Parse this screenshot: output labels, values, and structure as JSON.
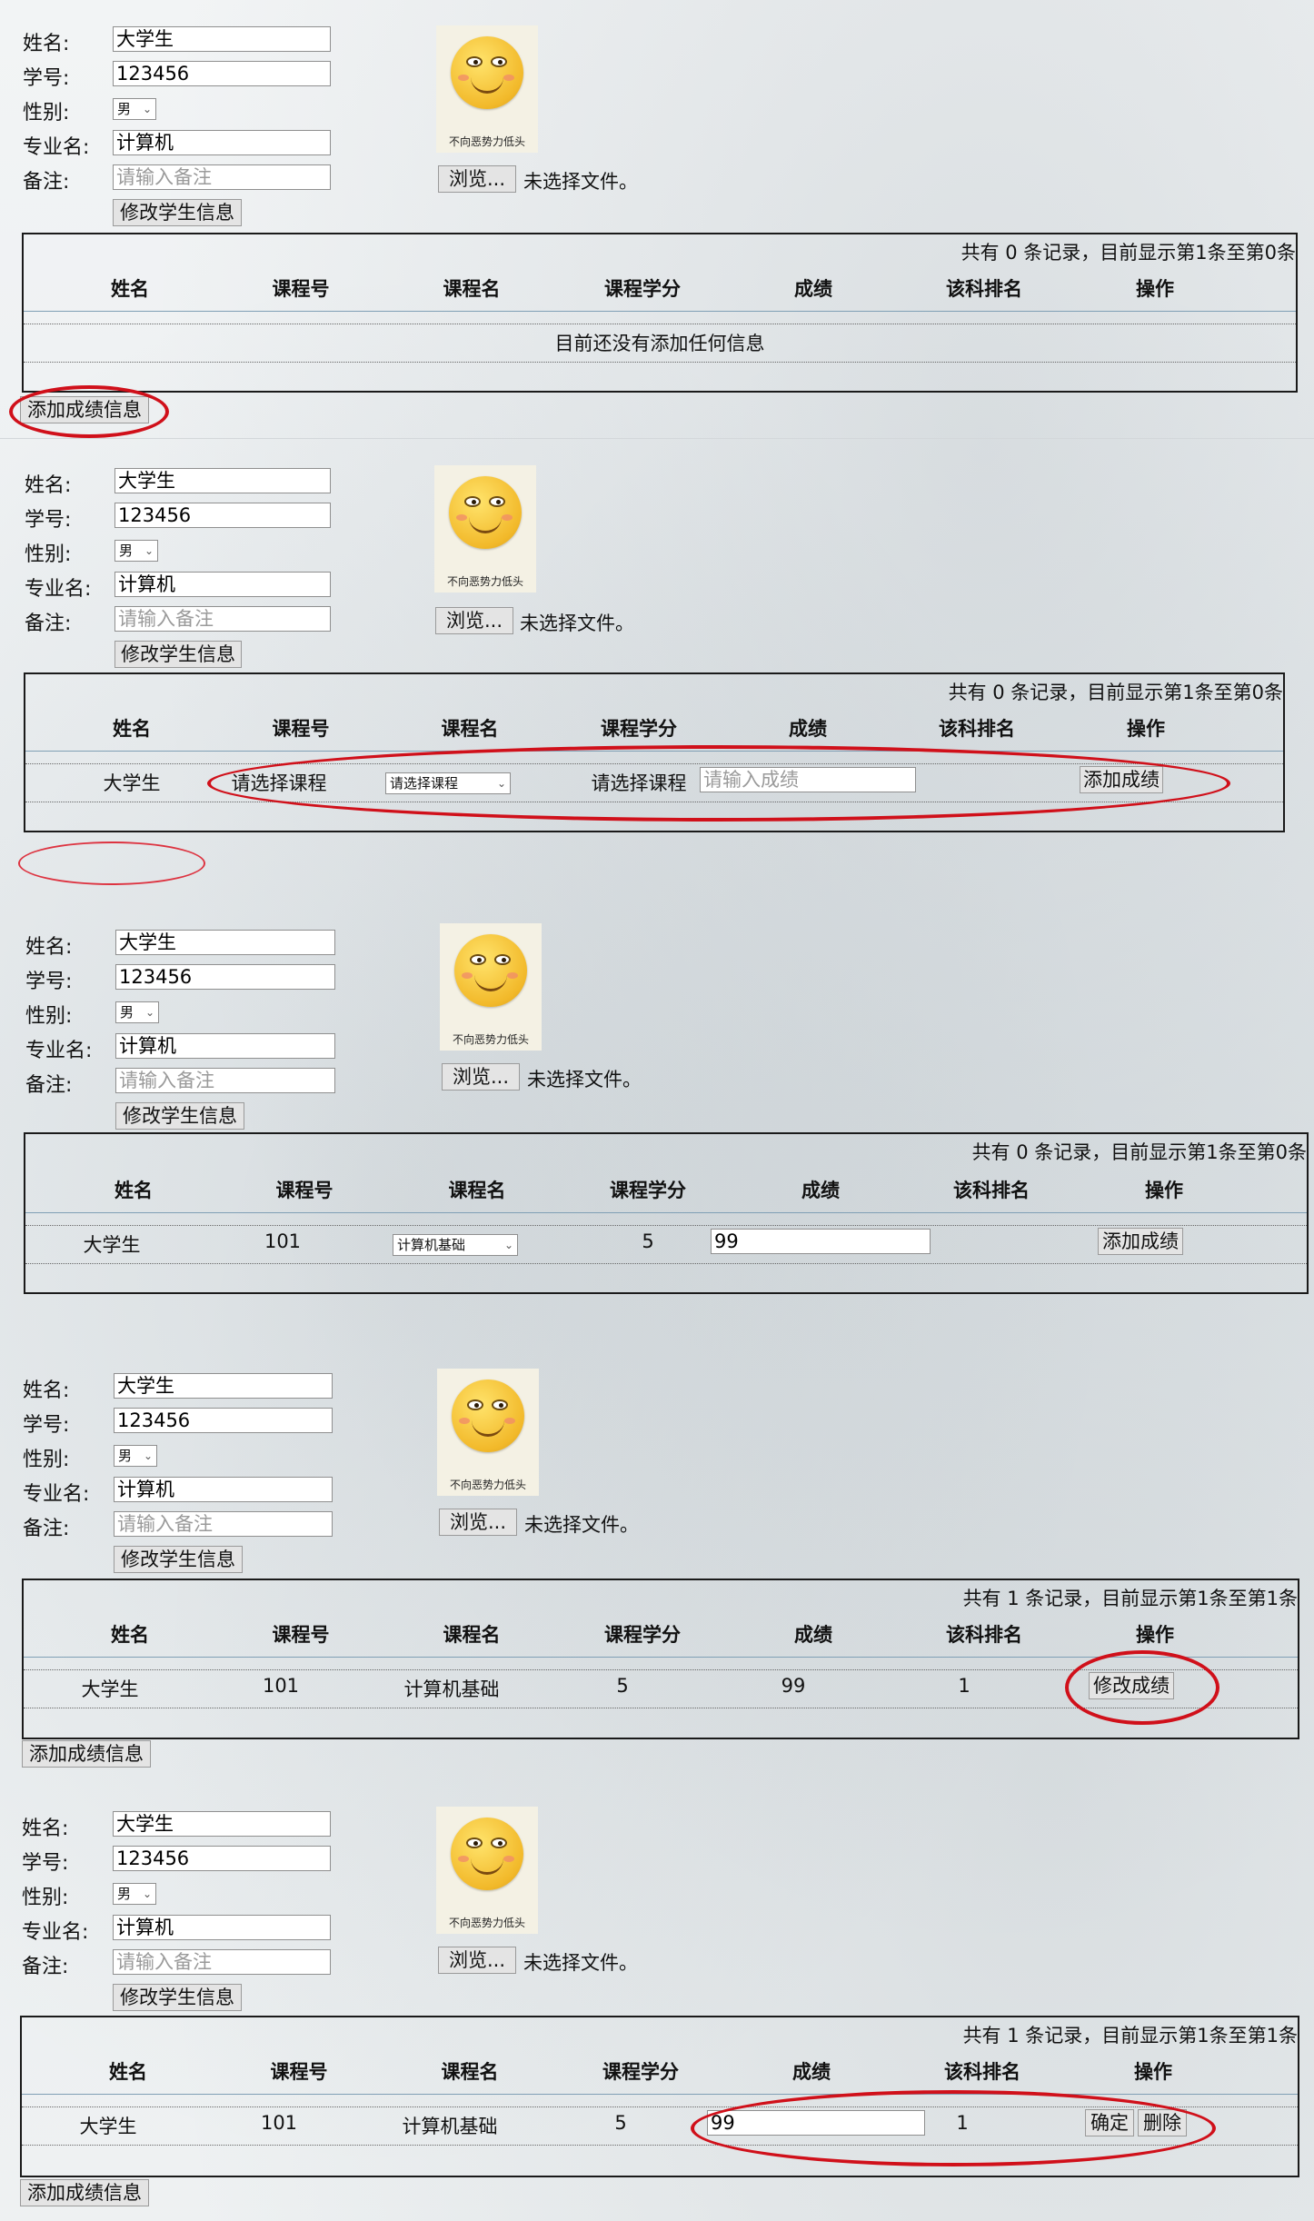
{
  "form": {
    "name_label": "姓名:",
    "id_label": "学号:",
    "gender_label": "性别:",
    "major_label": "专业名:",
    "note_label": "备注:",
    "name_value": "大学生",
    "id_value": "123456",
    "gender_value": "男",
    "major_value": "计算机",
    "note_placeholder": "请输入备注",
    "update_button": "修改学生信息",
    "avatar_caption": "不向恶势力低头",
    "browse_button": "浏览...",
    "no_file": "未选择文件。"
  },
  "table": {
    "headers": [
      "姓名",
      "课程号",
      "课程名",
      "课程学分",
      "成绩",
      "该科排名",
      "操作"
    ],
    "count_0": "共有 0 条记录，目前显示第1条至第0条",
    "count_1": "共有 1 条记录，目前显示第1条至第1条",
    "empty_text": "目前还没有添加任何信息",
    "add_score_info_button": "添加成绩信息"
  },
  "panel2_row": {
    "name": "大学生",
    "course_id": "请选择课程",
    "course_select": "请选择课程",
    "credit": "请选择课程",
    "score_placeholder": "请输入成绩",
    "action": "添加成绩"
  },
  "panel3_row": {
    "name": "大学生",
    "course_id": "101",
    "course_select": "计算机基础",
    "credit": "5",
    "score": "99",
    "action": "添加成绩"
  },
  "panel4_row": {
    "name": "大学生",
    "course_id": "101",
    "course_name": "计算机基础",
    "credit": "5",
    "score": "99",
    "rank": "1",
    "action": "修改成绩"
  },
  "panel5_row": {
    "name": "大学生",
    "course_id": "101",
    "course_name": "计算机基础",
    "credit": "5",
    "score": "99",
    "rank": "1",
    "confirm": "确定",
    "delete": "删除"
  },
  "colors": {
    "highlight_ring": "#d0101a",
    "table_border": "#1a1a1a",
    "header_rule": "#7f9fb5"
  }
}
